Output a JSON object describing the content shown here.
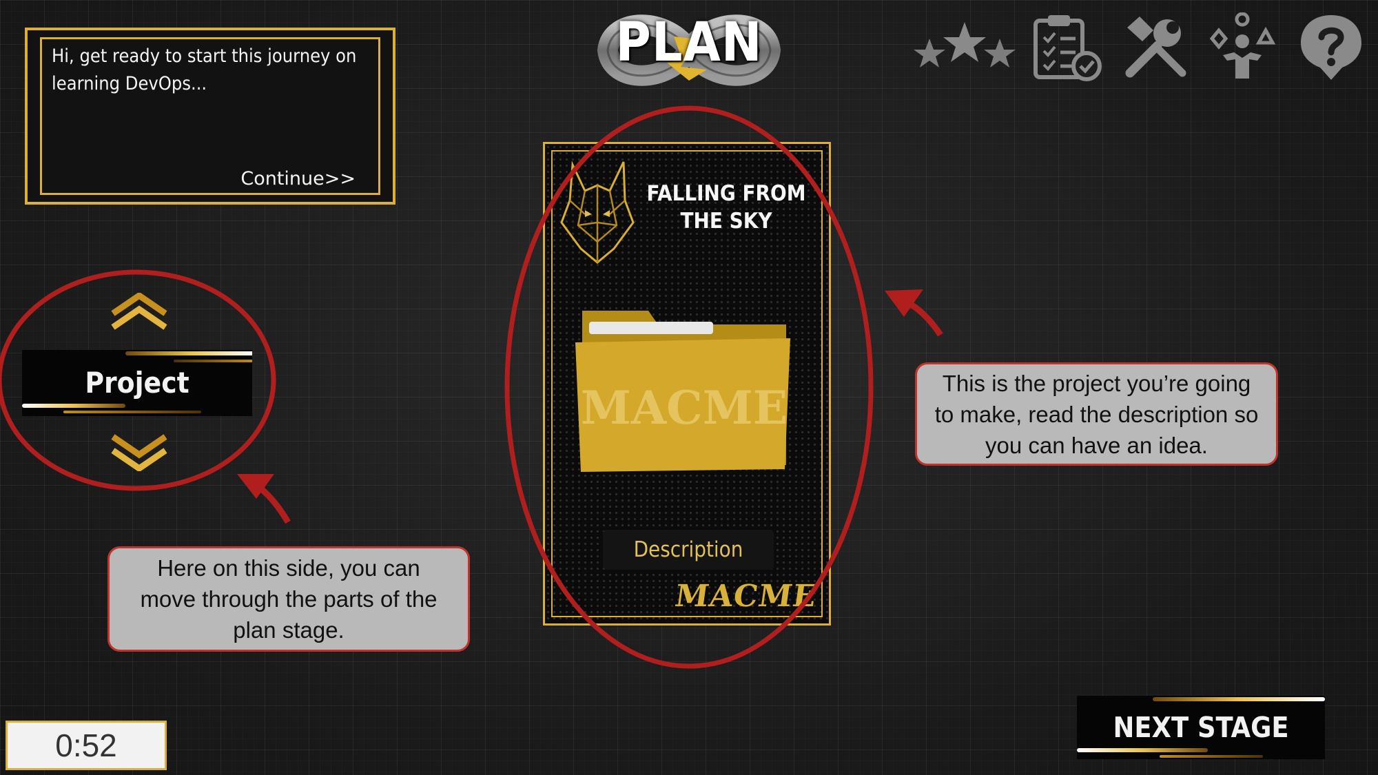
{
  "dialog": {
    "text": "Hi, get ready to start this journey on learning DevOps...",
    "continue_label": "Continue>>"
  },
  "header": {
    "stage_title": "PLAN"
  },
  "toolbar": {
    "icons": [
      "stars-rating-icon",
      "clipboard-checklist-icon",
      "tools-icon",
      "team-roles-icon",
      "help-icon"
    ]
  },
  "section_nav": {
    "current_section": "Project"
  },
  "project_card": {
    "title": "FALLING FROM THE SKY",
    "folder_label": "MACME",
    "description_label": "Description",
    "brand": "MACME"
  },
  "callouts": {
    "left": "Here on this side, you can move through the parts of the plan stage.",
    "right": "This is the project you’re going to make, read the description so you can have an idea."
  },
  "next_stage_label": "NEXT STAGE",
  "timer": "0:52",
  "colors": {
    "gold": "#d9b13a",
    "annotation_red": "#c2332b",
    "callout_bg": "#b9b9b9"
  }
}
